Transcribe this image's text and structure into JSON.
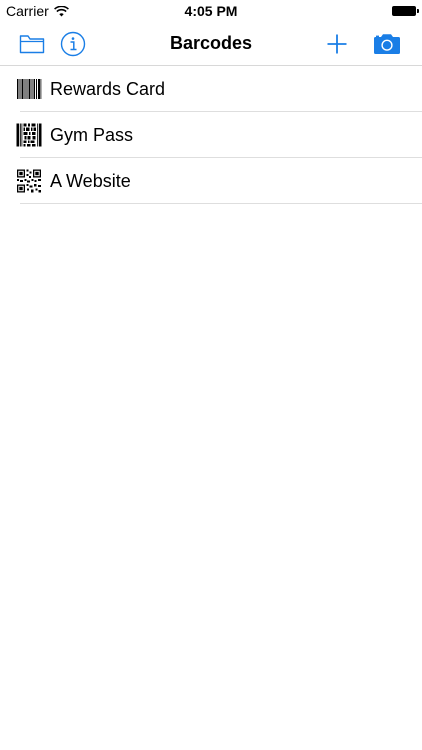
{
  "status_bar": {
    "carrier": "Carrier",
    "time": "4:05 PM"
  },
  "nav": {
    "title": "Barcodes",
    "icons": {
      "folder": "folder-icon",
      "info": "info-icon",
      "add": "plus-icon",
      "camera": "camera-icon"
    },
    "accent_color": "#1a7ee6"
  },
  "barcodes": [
    {
      "label": "Rewards Card",
      "icon": "linear-barcode-icon"
    },
    {
      "label": "Gym Pass",
      "icon": "pdf417-barcode-icon"
    },
    {
      "label": "A Website",
      "icon": "qr-code-icon"
    }
  ]
}
